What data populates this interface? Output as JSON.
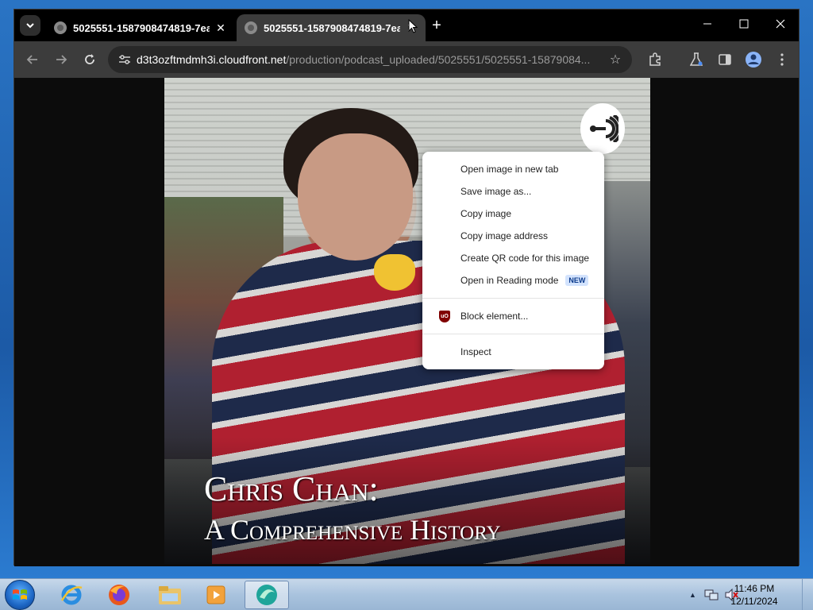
{
  "browser": {
    "tabs": [
      {
        "title": "5025551-1587908474819-7ea",
        "active": false
      },
      {
        "title": "5025551-1587908474819-7ea",
        "active": true
      }
    ],
    "address": {
      "host": "d3t3ozftmdmh3i.cloudfront.net",
      "path": "/production/podcast_uploaded/5025551/5025551-15879084..."
    }
  },
  "poster": {
    "title_line1": "Chris Chan:",
    "title_line2": "A Comprehensive History"
  },
  "context_menu": {
    "items": [
      {
        "label": "Open image in new tab"
      },
      {
        "label": "Save image as..."
      },
      {
        "label": "Copy image"
      },
      {
        "label": "Copy image address"
      },
      {
        "label": "Create QR code for this image"
      },
      {
        "label": "Open in Reading mode",
        "badge": "NEW"
      }
    ],
    "extension_item": {
      "label": "Block element...",
      "icon": "ublock-origin-icon"
    },
    "inspect_item": {
      "label": "Inspect"
    }
  },
  "taskbar": {
    "apps": [
      "internet-explorer-icon",
      "firefox-icon",
      "file-explorer-icon",
      "media-player-icon",
      "browser-app-icon"
    ],
    "clock": {
      "time": "11:46 PM",
      "date": "12/11/2024"
    }
  },
  "colors": {
    "tab_strip": "#000000",
    "toolbar": "#3c3c3c",
    "menu_bg": "#ffffff",
    "new_badge": "#d3e3fd"
  }
}
